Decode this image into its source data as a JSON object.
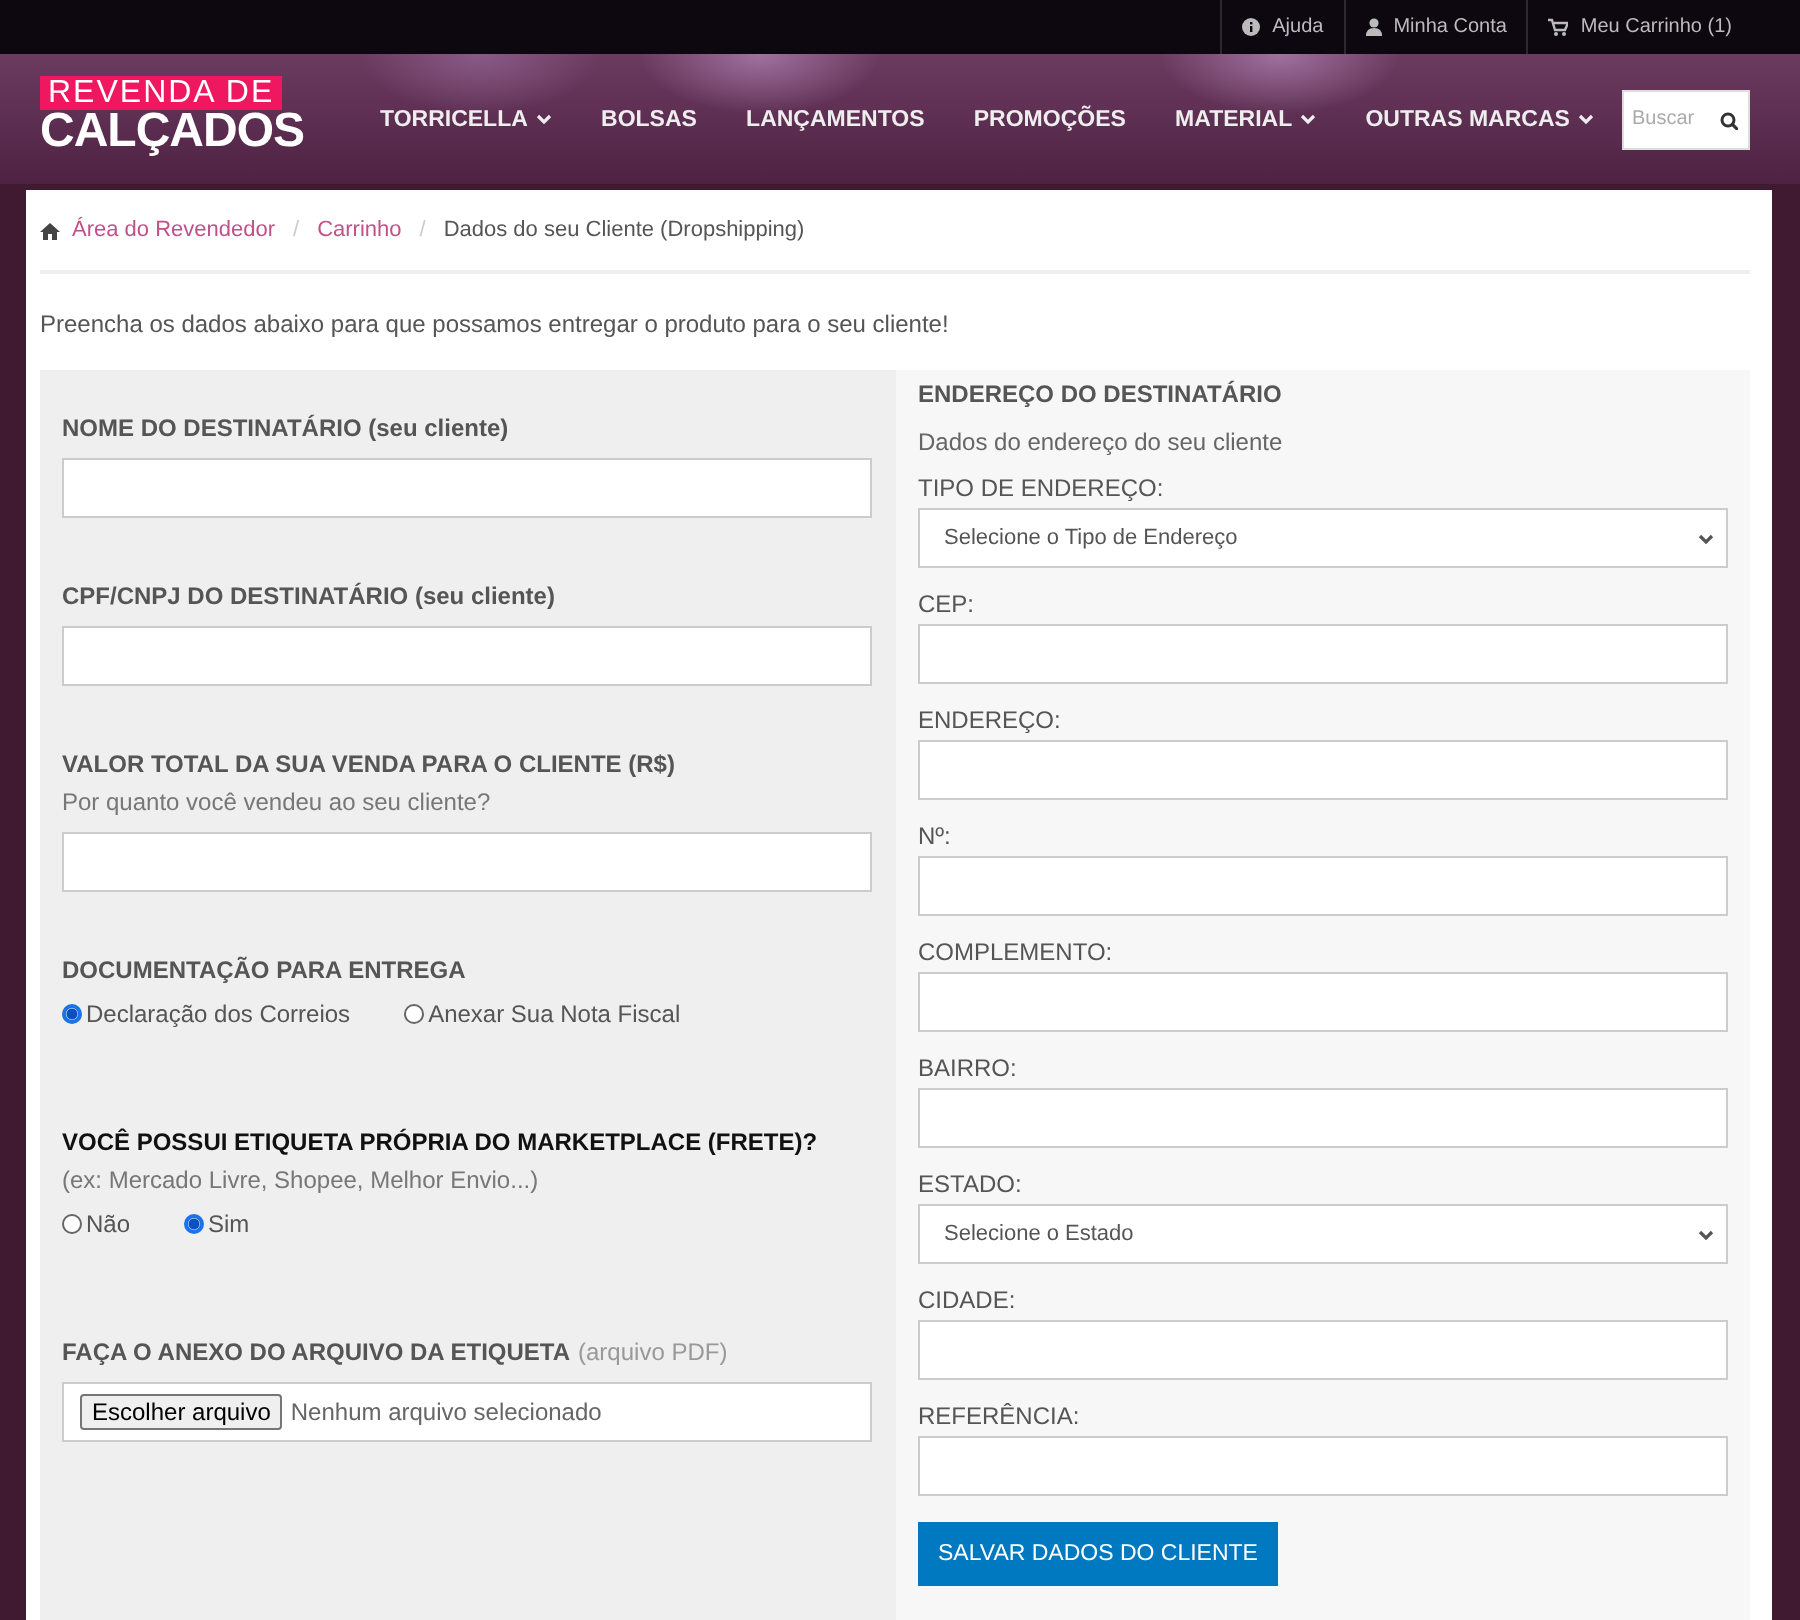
{
  "top_links": [
    {
      "label": "Ajuda"
    },
    {
      "label": "Minha Conta"
    },
    {
      "label": "Meu Carrinho (1)"
    }
  ],
  "logo": {
    "line_1": "REVENDA DE",
    "line_2": "CALÇADOS"
  },
  "nav": [
    {
      "label": "TORRICELLA",
      "dropdown": true
    },
    {
      "label": "BOLSAS",
      "dropdown": false
    },
    {
      "label": "LANÇAMENTOS",
      "dropdown": false
    },
    {
      "label": "PROMOÇÕES",
      "dropdown": false
    },
    {
      "label": "MATERIAL",
      "dropdown": true
    },
    {
      "label": "OUTRAS MARCAS",
      "dropdown": true
    }
  ],
  "search": {
    "placeholder": "Buscar"
  },
  "breadcrumb": [
    {
      "label": "Área do Revendedor",
      "link": true
    },
    {
      "separator": "/",
      "label": "Carrinho",
      "link": true
    },
    {
      "separator": "/",
      "label": "Dados do seu Cliente (Dropshipping)",
      "link": false
    }
  ],
  "intro": "Preencha os dados abaixo para que possamos entregar o produto para o seu cliente!",
  "left_fields": [
    {
      "kind": "text",
      "label": "NOME DO DESTINATÁRIO (seu cliente)"
    },
    {
      "kind": "text",
      "label": "CPF/CNPJ DO DESTINATÁRIO (seu cliente)"
    },
    {
      "kind": "text",
      "label": "VALOR TOTAL DA SUA VENDA PARA O CLIENTE (R$)",
      "hint": "Por quanto você vendeu ao seu cliente?"
    },
    {
      "kind": "radio",
      "label": "DOCUMENTAÇÃO PARA ENTREGA",
      "options": [
        {
          "label": "Declaração dos Correios",
          "selected": true
        },
        {
          "label": "Anexar Sua Nota Fiscal",
          "selected": false
        }
      ]
    },
    {
      "kind": "radio",
      "label": "VOCÊ POSSUI ETIQUETA PRÓPRIA DO MARKETPLACE (FRETE)?",
      "hint": "(ex: Mercado Livre, Shopee, Melhor Envio...)",
      "options": [
        {
          "label": "Não",
          "selected": false
        },
        {
          "label": "Sim",
          "selected": true
        }
      ]
    },
    {
      "kind": "file",
      "label": "FAÇA O ANEXO DO ARQUIVO DA ETIQUETA",
      "note": "(arquivo PDF)",
      "button": "Escolher arquivo",
      "status": "Nenhum arquivo selecionado"
    }
  ],
  "address": {
    "heading": "ENDEREÇO DO DESTINATÁRIO",
    "subheading": "Dados do endereço do seu cliente",
    "fields": [
      {
        "kind": "select",
        "label": "TIPO DE ENDEREÇO:",
        "value": "Selecione o Tipo de Endereço"
      },
      {
        "kind": "text",
        "label": "CEP:"
      },
      {
        "kind": "text",
        "label": "ENDEREÇO:"
      },
      {
        "kind": "text",
        "label": "Nº:"
      },
      {
        "kind": "text",
        "label": "COMPLEMENTO:"
      },
      {
        "kind": "text",
        "label": "BAIRRO:"
      },
      {
        "kind": "select",
        "label": "ESTADO:",
        "value": "Selecione o Estado"
      },
      {
        "kind": "text",
        "label": "CIDADE:"
      },
      {
        "kind": "text",
        "label": "REFERÊNCIA:"
      }
    ],
    "button": "SALVAR DADOS DO CLIENTE"
  }
}
